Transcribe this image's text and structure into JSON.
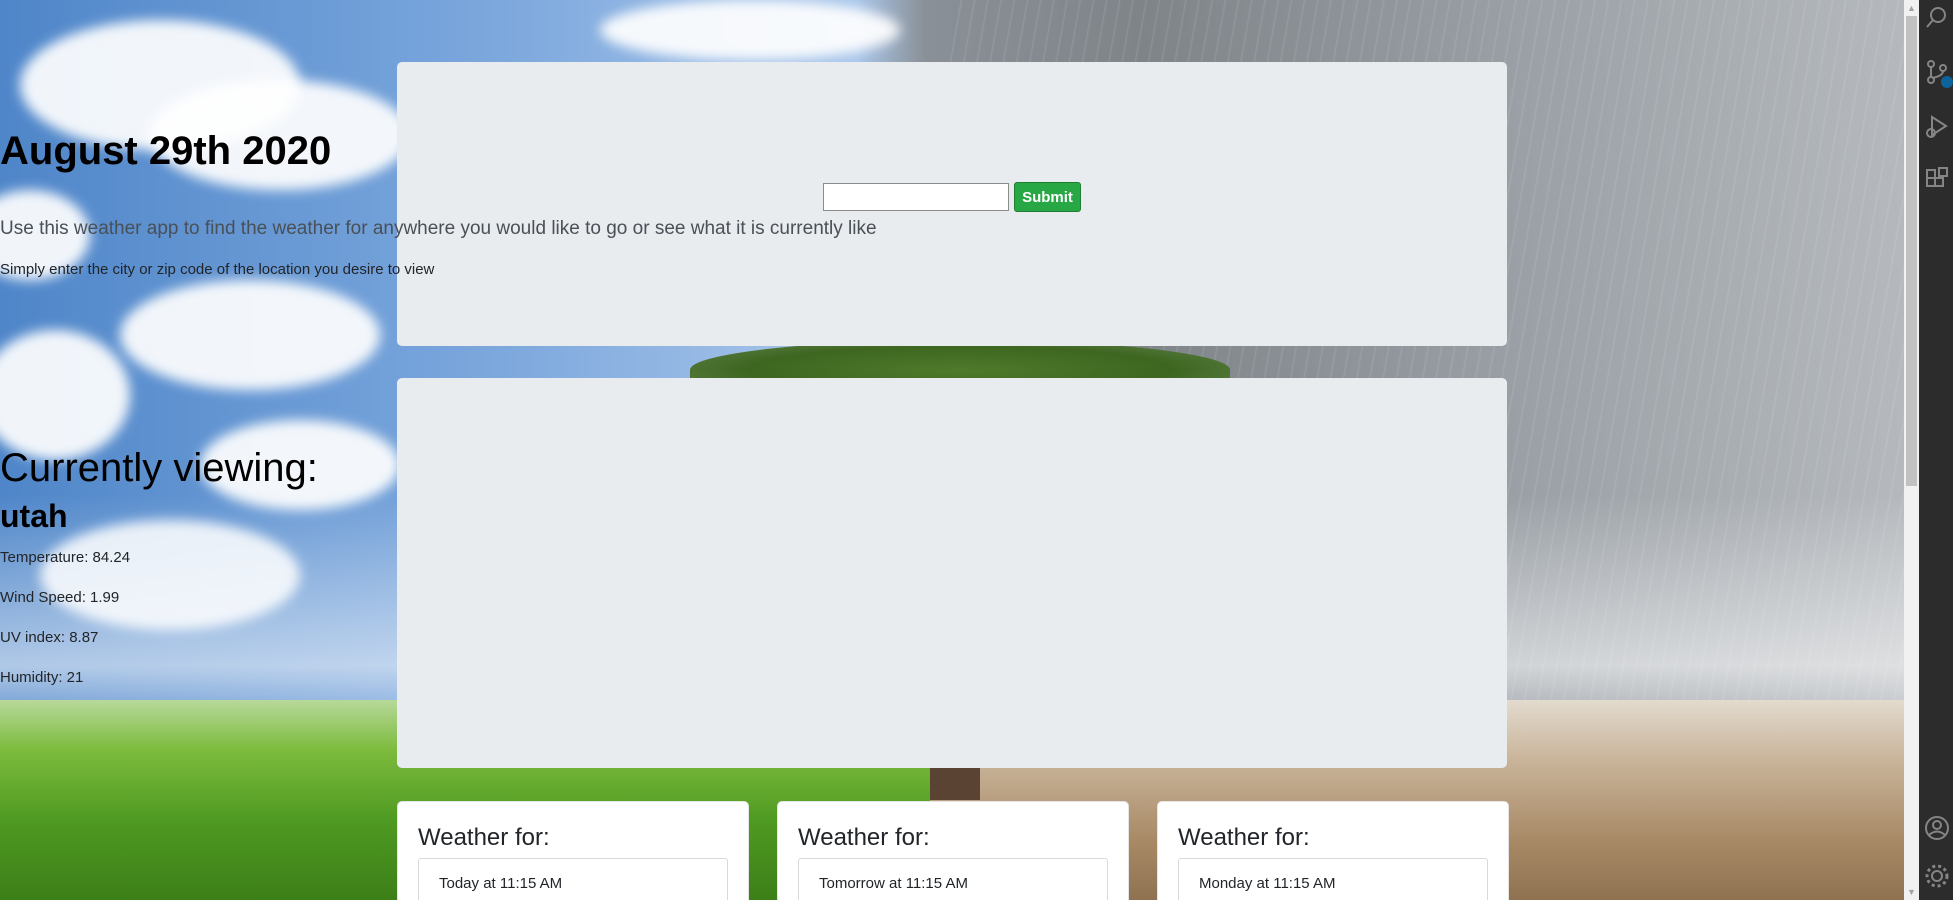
{
  "header": {
    "date": "August 29th 2020",
    "search": {
      "value": "",
      "placeholder": ""
    },
    "submit_label": "Submit",
    "lead_text": "Use this weather app to find the weather for anywhere you would like to go or see what it is currently like",
    "hint_text": "Simply enter the city or zip code of the location you desire to view"
  },
  "current": {
    "heading": "Currently viewing:",
    "city": "utah",
    "temperature": "Temperature: 84.24",
    "wind_speed": "Wind Speed: 1.99",
    "uv_index": "UV index: 8.87",
    "humidity": "Humidity: 21"
  },
  "forecast": [
    {
      "title": "Weather for:",
      "time": "Today at 11:15 AM"
    },
    {
      "title": "Weather for:",
      "time": "Tomorrow at 11:15 AM"
    },
    {
      "title": "Weather for:",
      "time": "Monday at 11:15 AM"
    }
  ],
  "sidebar_icons": [
    "search-icon",
    "source-control-icon",
    "run-debug-icon",
    "extensions-icon",
    "account-icon",
    "settings-gear-icon"
  ],
  "colors": {
    "panel_bg": "#e9ecef",
    "submit_green": "#28a745",
    "text_dark": "#212529",
    "activity_bar": "#2c2c2c"
  }
}
